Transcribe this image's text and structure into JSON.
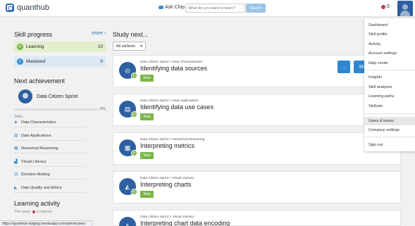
{
  "header": {
    "app_name": "quanthub",
    "ask_chip": "Ask Chip",
    "search_placeholder": "What do you want to learn?",
    "search_button": "Search",
    "neuron_count": "0"
  },
  "sidebar": {
    "skill_progress_title": "Skill progress",
    "more_link": "more",
    "progress": [
      {
        "label": "Learning",
        "count": "10"
      },
      {
        "label": "Mastered",
        "count": "0"
      }
    ],
    "next_achievement_title": "Next achievement",
    "achievement": {
      "name": "Data Citizen Sprint",
      "percent_label": "0%",
      "progress_fraction": 0,
      "skills_label": "Skills:",
      "skills": [
        {
          "label": "Data Characteristics",
          "icon": "cube-icon"
        },
        {
          "label": "Data Applications",
          "icon": "grid-icon"
        },
        {
          "label": "Numerical Reasoning",
          "icon": "abacus-icon"
        },
        {
          "label": "Visual Literacy",
          "icon": "chart-icon"
        },
        {
          "label": "Decision-Making",
          "icon": "network-icon"
        },
        {
          "label": "Data Quality and Ethics",
          "icon": "line-chart-icon"
        }
      ]
    },
    "learning_activity_title": "Learning activity",
    "this_week_label": "This week:",
    "this_week_value": "0 neurons"
  },
  "main": {
    "title": "Study next...",
    "filter_label": "All skillsets",
    "cards": [
      {
        "crumb": "Data Citizen Sprint > Data Characteristics",
        "title": "Identifying data sources",
        "status": "New",
        "icon": "signal-icon"
      },
      {
        "crumb": "Data Citizen Sprint > Data Applications",
        "title": "Identifying data use cases",
        "status": "New",
        "icon": "server-icon"
      },
      {
        "crumb": "Data Citizen Sprint > Numerical Reasoning",
        "title": "Interpreting metrics",
        "status": "New",
        "icon": "calculator-icon"
      },
      {
        "crumb": "Data Citizen Sprint > Visual Literacy",
        "title": "Interpreting charts",
        "status": "New",
        "icon": "chart-icon"
      },
      {
        "crumb": "Data Citizen Sprint > Visual Literacy",
        "title": "Interpreting chart data encoding",
        "status": "",
        "icon": "chart-icon"
      }
    ],
    "card_actions": [
      "...",
      "Ma"
    ]
  },
  "dropdown": {
    "groups": [
      [
        "Dashboard",
        "Skill profile",
        "Activity",
        "Account settings",
        "Help center"
      ],
      [
        "Insights",
        "Skill analyses",
        "Learning paths",
        "Skillsets"
      ],
      [
        "Users & teams",
        "Company settings"
      ],
      [
        "Sign out"
      ]
    ],
    "active_item": "Users & teams"
  },
  "status_bar": {
    "url": "https://quanthub-staging.herokuapp.com/admin/users"
  },
  "colors": {
    "brand_blue": "#2d5fa1",
    "action_blue": "#2f86d0",
    "learning_green": "#7ab648",
    "neuron_red": "#c8374f"
  }
}
